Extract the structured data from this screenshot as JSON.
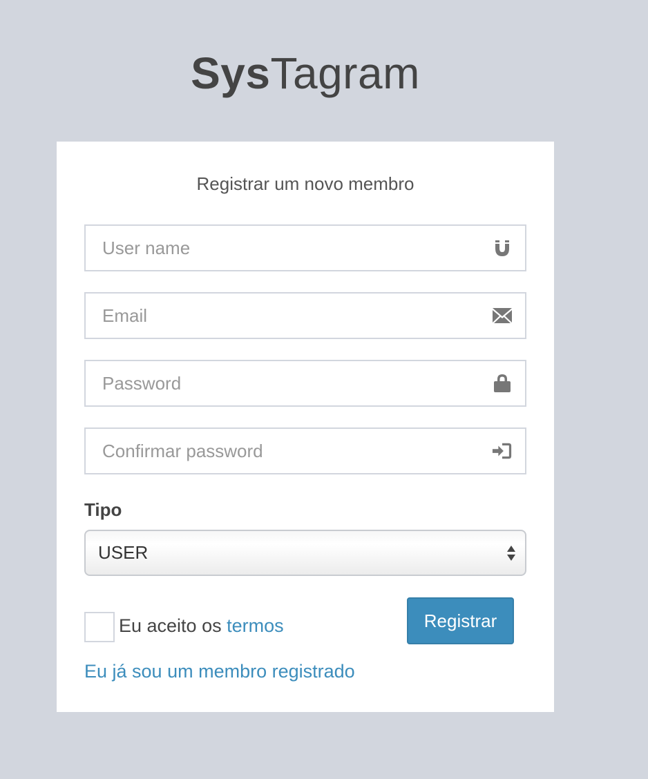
{
  "logo": {
    "bold": "Sys",
    "light": "Tagram"
  },
  "register_box": {
    "message": "Registrar um novo membro",
    "fields": [
      {
        "placeholder": "User name",
        "value": "",
        "icon": "magnet-icon"
      },
      {
        "placeholder": "Email",
        "value": "",
        "icon": "envelope-icon"
      },
      {
        "placeholder": "Password",
        "value": "",
        "icon": "lock-icon"
      },
      {
        "placeholder": "Confirmar password",
        "value": "",
        "icon": "sign-in-icon"
      }
    ],
    "tipo_label": "Tipo",
    "tipo_select": {
      "selected": "USER"
    },
    "terms": {
      "prefix": "Eu aceito os ",
      "link": "termos",
      "checked": false
    },
    "register_button": "Registrar",
    "member_link": "Eu já sou um membro registrado"
  },
  "colors": {
    "background": "#d2d6de",
    "accent": "#3c8dbc",
    "box": "#ffffff"
  }
}
